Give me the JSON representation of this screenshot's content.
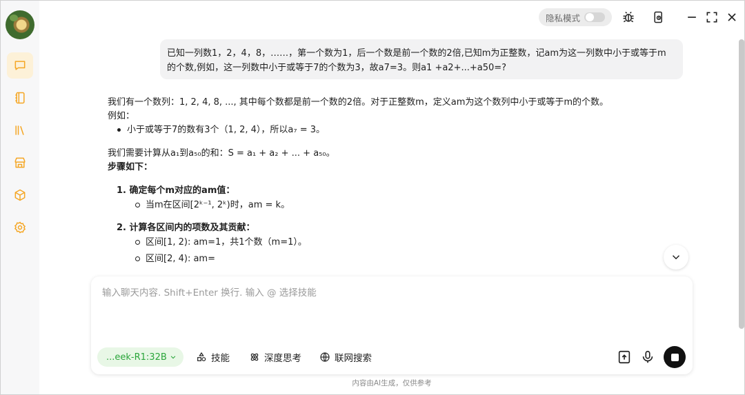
{
  "colors": {
    "accent": "#f5a623",
    "model_pill_bg": "#e8f7e6",
    "model_pill_text": "#2aa53a",
    "sidebar_bg": "#f7f7f8"
  },
  "sidebar": {
    "items": [
      {
        "icon": "chat-icon",
        "active": true
      },
      {
        "icon": "notebook-icon",
        "active": false
      },
      {
        "icon": "library-icon",
        "active": false
      },
      {
        "icon": "store-icon",
        "active": false
      },
      {
        "icon": "cube-icon",
        "active": false
      },
      {
        "icon": "gear-icon",
        "active": false
      }
    ]
  },
  "topbar": {
    "private_mode_label": "隐私模式",
    "private_mode_on": false
  },
  "conversation": {
    "user_line1": "已知一列数1，2，4，8，……，第一个数为1，后一个数是前一个数的2倍,已知m为正整数，记am为这一列数中小于或等于m",
    "user_line2": "的个数,例如，这一列数中小于或等于7的个数为3，故a7=3。则a1 +a2+...+a50=?",
    "a_line1": "我们有一个数列：1, 2, 4, 8, ..., 其中每个数都是前一个数的2倍。对于正整数m，定义am为这个数列中小于或等于m的个数。",
    "a_line2": "例如：",
    "a_bullet1": "小于或等于7的数有3个（1, 2, 4），所以a₇ = 3。",
    "a_line3": "我们需要计算从a₁到a₅₀的和：S = a₁ + a₂ + ... + a₅₀。",
    "a_steps_heading": "步骤如下：",
    "step1_num": "1.",
    "step1_title": "确定每个m对应的am值：",
    "step1_sub1": "当m在区间[2ᵏ⁻¹, 2ᵏ)时，am = k。",
    "step2_num": "2.",
    "step2_title": "计算各区间内的项数及其贡献：",
    "step2_sub1": "区间[1, 2): am=1，共1个数（m=1）。",
    "step2_sub2": "区间[2, 4): am="
  },
  "composer": {
    "placeholder": "输入聊天内容. Shift+Enter 换行. 输入 @ 选择技能",
    "model_label": "...eek-R1:32B",
    "skills_label": "技能",
    "deep_think_label": "深度思考",
    "web_search_label": "联网搜索"
  },
  "footer": {
    "disclaimer": "内容由AI生成，仅供参考"
  }
}
